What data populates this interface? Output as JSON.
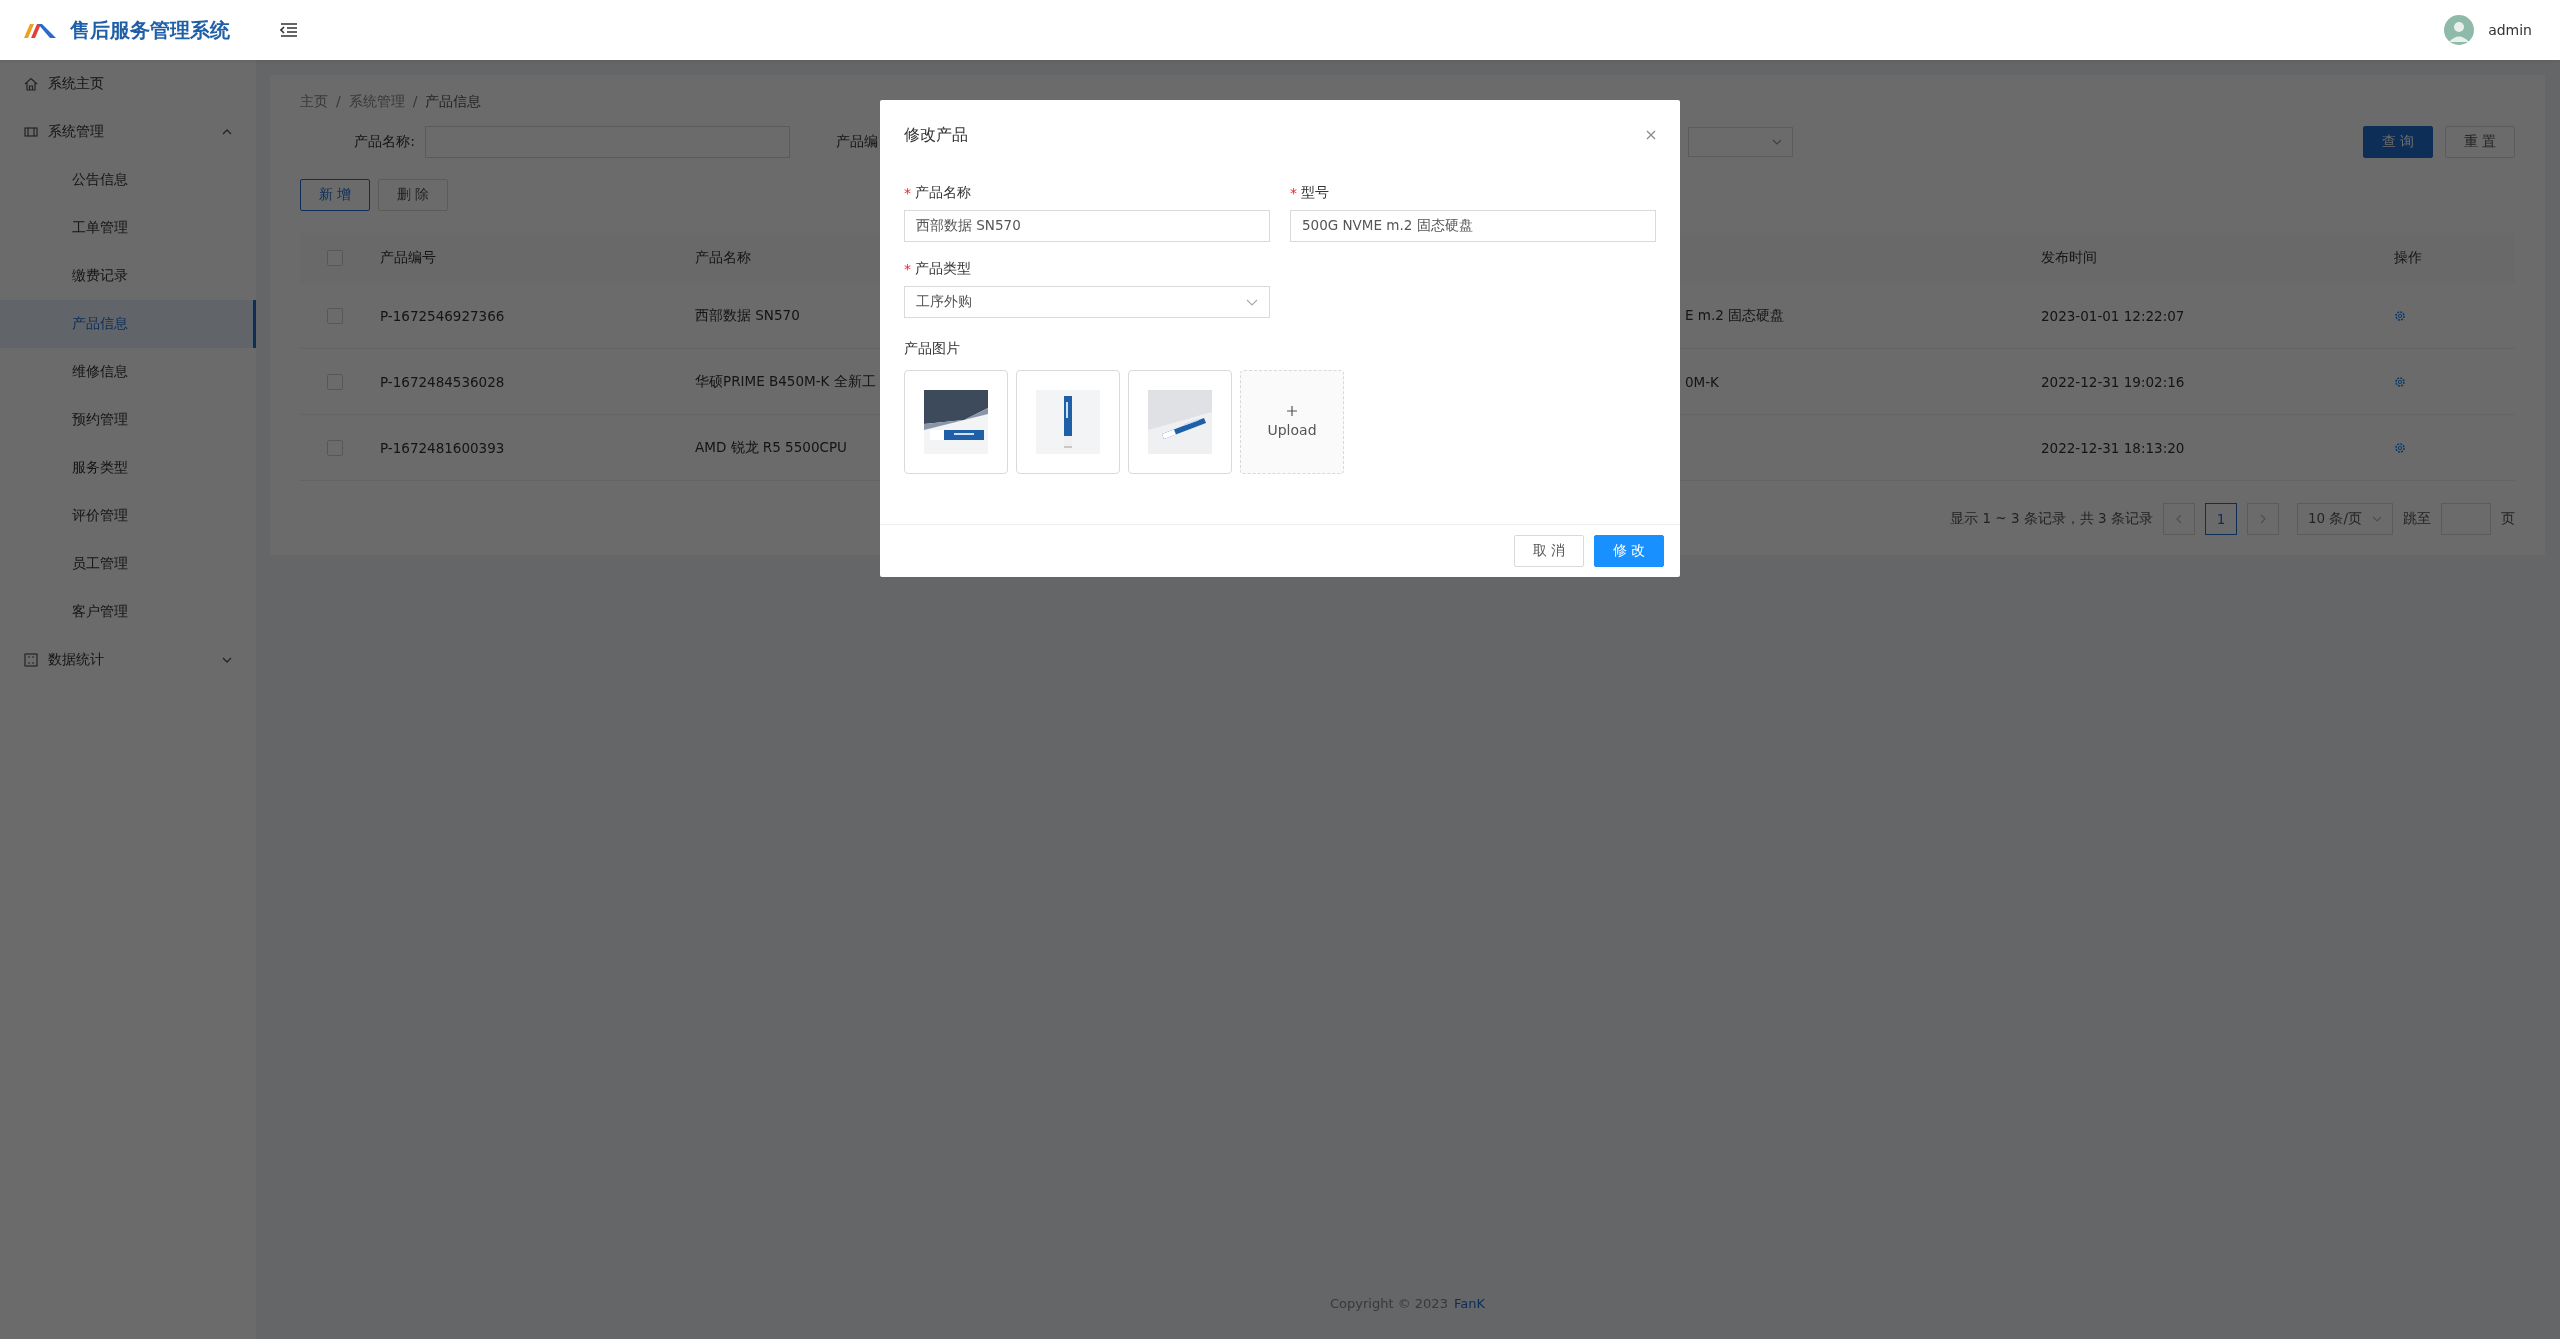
{
  "header": {
    "app_title": "售后服务管理系统",
    "user": "admin"
  },
  "sidebar": {
    "items": [
      {
        "label": "系统主页",
        "selected": false
      },
      {
        "label": "系统管理",
        "selected": false,
        "expanded": true,
        "children": [
          {
            "label": "公告信息",
            "selected": false
          },
          {
            "label": "工单管理",
            "selected": false
          },
          {
            "label": "缴费记录",
            "selected": false
          },
          {
            "label": "产品信息",
            "selected": true
          },
          {
            "label": "维修信息",
            "selected": false
          },
          {
            "label": "预约管理",
            "selected": false
          },
          {
            "label": "服务类型",
            "selected": false
          },
          {
            "label": "评价管理",
            "selected": false
          },
          {
            "label": "员工管理",
            "selected": false
          },
          {
            "label": "客户管理",
            "selected": false
          }
        ]
      },
      {
        "label": "数据统计",
        "selected": false,
        "expanded": false
      }
    ]
  },
  "breadcrumb": [
    {
      "kind": "link",
      "text": "主页"
    },
    {
      "kind": "separator",
      "text": "/"
    },
    {
      "kind": "link",
      "text": "系统管理"
    },
    {
      "kind": "separator",
      "text": "/"
    },
    {
      "kind": "current",
      "text": "产品信息"
    }
  ],
  "search": {
    "fields": [
      {
        "label": "产品名称:"
      },
      {
        "label": "产品编"
      }
    ],
    "buttons": [
      {
        "label": "查询",
        "primary": true
      },
      {
        "label": "重置",
        "primary": false
      }
    ]
  },
  "toolbar": {
    "buttons": [
      {
        "label": "新增",
        "primary": true
      },
      {
        "label": "删除",
        "primary": false
      }
    ]
  },
  "table": {
    "all_checked": false,
    "columns": [
      "产品编号",
      "产品名称",
      "发布时间",
      "操作"
    ],
    "rows": [
      {
        "checked": false,
        "product_no": "P-1672546927366",
        "product_name": "西部数据 SN570",
        "column_3": "E m.2 固态硬盘",
        "published": "2023-01-01 12:22:07"
      },
      {
        "checked": false,
        "product_no": "P-1672484536028",
        "product_name": "华硕PRIME B450M-K 全新工",
        "column_3": "0M-K",
        "published": "2022-12-31 19:02:16"
      },
      {
        "checked": false,
        "product_no": "P-1672481600393",
        "product_name": "AMD 锐龙 R5 5500CPU",
        "published": "2022-12-31 18:13:20"
      }
    ]
  },
  "pagination": {
    "summary": "显示 1 ~ 3 条记录，共 3 条记录",
    "pages": [
      {
        "label": "1",
        "selected": true
      }
    ],
    "page_size": "10 条/页",
    "jump_label": "跳至",
    "page_suffix": "页"
  },
  "footer": {
    "text": "Copyright © 2023",
    "link": "FanK"
  },
  "modal": {
    "title": "修改产品",
    "fields": [
      {
        "kind": "input",
        "label": "产品名称",
        "required_mark": "*",
        "value": "西部数据 SN570"
      },
      {
        "kind": "input",
        "label": "型号",
        "required_mark": "*",
        "value": "500G NVME m.2 固态硬盘"
      },
      {
        "kind": "select",
        "label": "产品类型",
        "required_mark": "*",
        "value": "工序外购"
      }
    ],
    "images_label": "产品图片",
    "upload_label": "Upload",
    "buttons": [
      {
        "label": "取消",
        "primary": false
      },
      {
        "label": "修改",
        "primary": true
      }
    ]
  }
}
